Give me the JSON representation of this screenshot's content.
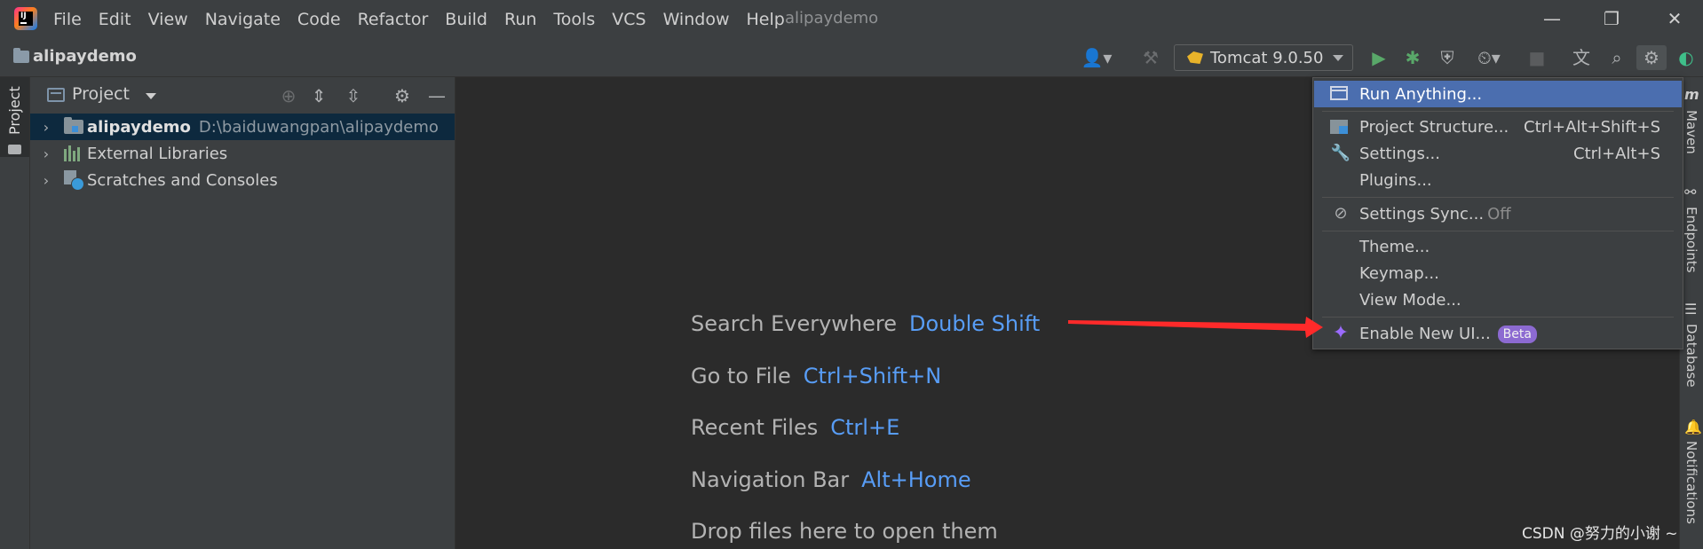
{
  "titlebar": {
    "menu": [
      "File",
      "Edit",
      "View",
      "Navigate",
      "Code",
      "Refactor",
      "Build",
      "Run",
      "Tools",
      "VCS",
      "Window",
      "Help"
    ],
    "window_title": "alipaydemo",
    "minimize": "—",
    "restore": "❐",
    "close": "✕"
  },
  "toolbar": {
    "breadcrumb": "alipaydemo",
    "run_config": "Tomcat 9.0.50"
  },
  "left_stripe": {
    "tab_label": "Project"
  },
  "project_panel": {
    "title": "Project",
    "tree": [
      {
        "name": "alipaydemo",
        "path": "D:\\baiduwangpan\\alipaydemo",
        "selected": true
      },
      {
        "name": "External Libraries"
      },
      {
        "name": "Scratches and Consoles"
      }
    ]
  },
  "editor": {
    "hints": [
      {
        "label": "Search Everywhere",
        "shortcut": "Double Shift"
      },
      {
        "label": "Go to File",
        "shortcut": "Ctrl+Shift+N"
      },
      {
        "label": "Recent Files",
        "shortcut": "Ctrl+E"
      },
      {
        "label": "Navigation Bar",
        "shortcut": "Alt+Home"
      },
      {
        "label": "Drop files here to open them",
        "shortcut": ""
      }
    ]
  },
  "right_stripe": [
    "Maven",
    "Endpoints",
    "Database",
    "Notifications"
  ],
  "settings_menu": {
    "items": [
      {
        "label": "Run Anything...",
        "shortcut": "",
        "highlighted": true
      },
      {
        "label": "Project Structure...",
        "shortcut": "Ctrl+Alt+Shift+S"
      },
      {
        "label": "Settings...",
        "shortcut": "Ctrl+Alt+S"
      },
      {
        "label": "Plugins...",
        "shortcut": ""
      },
      {
        "label": "Settings Sync...",
        "suffix": "Off"
      },
      {
        "label": "Theme...",
        "shortcut": ""
      },
      {
        "label": "Keymap...",
        "shortcut": ""
      },
      {
        "label": "View Mode...",
        "shortcut": ""
      },
      {
        "label": "Enable New UI...",
        "badge": "Beta"
      }
    ]
  },
  "colors": {
    "accent_blue": "#4b6eaf",
    "shortcut_blue": "#589df6",
    "annotation_red": "#ff2a2a",
    "beta_badge": "#8c6ad1"
  },
  "watermark": "CSDN @努力的小谢 ~"
}
